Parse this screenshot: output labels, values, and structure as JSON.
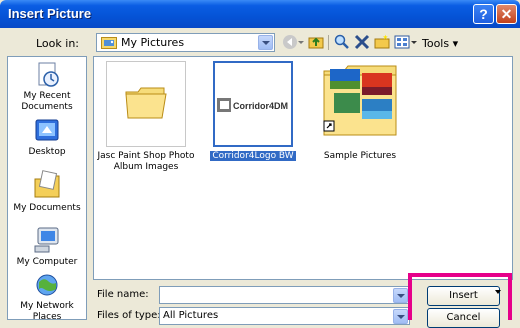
{
  "window": {
    "title": "Insert Picture",
    "help_glyph": "?",
    "close_glyph": "✕"
  },
  "lookin": {
    "label": "Look in:",
    "value": "My Pictures"
  },
  "toolbar": {
    "tools_label": "Tools ▾"
  },
  "places": [
    {
      "label": "My Recent Documents",
      "icon": "recent-documents-icon"
    },
    {
      "label": "Desktop",
      "icon": "desktop-icon"
    },
    {
      "label": "My Documents",
      "icon": "my-documents-icon"
    },
    {
      "label": "My Computer",
      "icon": "my-computer-icon"
    },
    {
      "label": "My Network Places",
      "icon": "network-places-icon"
    }
  ],
  "files": [
    {
      "label": "Jasc Paint Shop Photo Album Images",
      "type": "folder"
    },
    {
      "label": "Corridor4Logo BW",
      "type": "image",
      "logo_text": "Corridor4DM",
      "selected": true
    },
    {
      "label": "Sample Pictures",
      "type": "folder-shortcut"
    }
  ],
  "bottom": {
    "file_name_label": "File name:",
    "file_name_value": "",
    "file_type_label": "Files of type:",
    "file_type_value": "All Pictures",
    "insert_label": "Insert",
    "cancel_label": "Cancel"
  },
  "colors": {
    "highlight_box": "#e6008a",
    "selection": "#316ac5"
  }
}
